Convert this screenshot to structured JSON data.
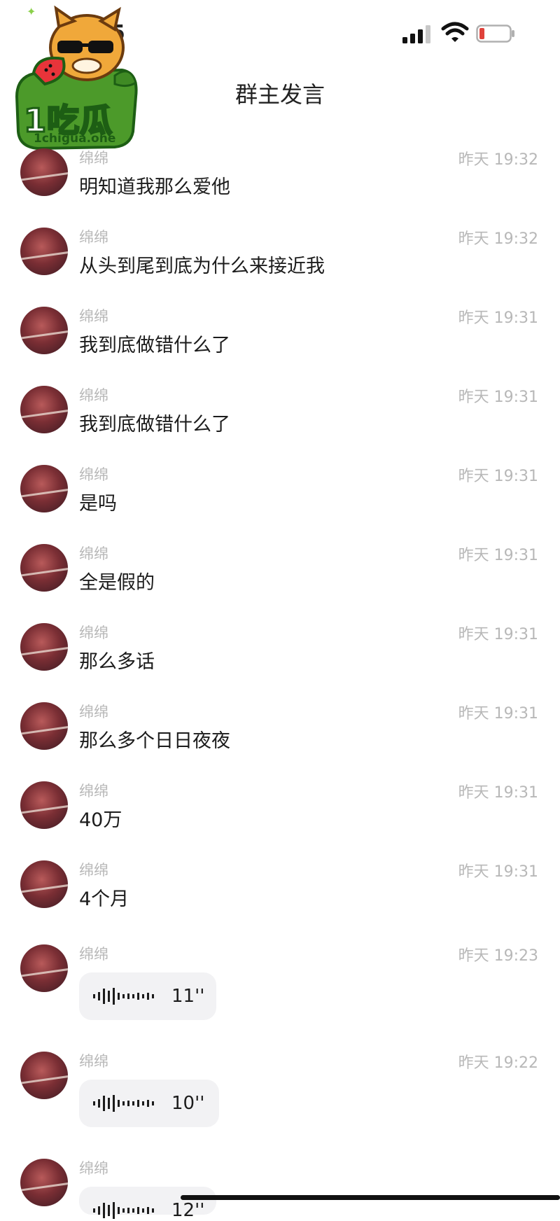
{
  "status_bar": {
    "time": "5"
  },
  "logo": {
    "title": "1吃瓜",
    "site": "1chigua.one"
  },
  "header": {
    "title": "群主发言"
  },
  "messages": [
    {
      "sender": "绵绵",
      "time": "昨天 19:32",
      "text": "明知道我那么爱他"
    },
    {
      "sender": "绵绵",
      "time": "昨天 19:32",
      "text": "从头到尾到底为什么来接近我"
    },
    {
      "sender": "绵绵",
      "time": "昨天 19:31",
      "text": "我到底做错什么了"
    },
    {
      "sender": "绵绵",
      "time": "昨天 19:31",
      "text": "我到底做错什么了"
    },
    {
      "sender": "绵绵",
      "time": "昨天 19:31",
      "text": "是吗"
    },
    {
      "sender": "绵绵",
      "time": "昨天 19:31",
      "text": "全是假的"
    },
    {
      "sender": "绵绵",
      "time": "昨天 19:31",
      "text": "那么多话"
    },
    {
      "sender": "绵绵",
      "time": "昨天 19:31",
      "text": "那么多个日日夜夜"
    },
    {
      "sender": "绵绵",
      "time": "昨天 19:31",
      "text": "40万"
    },
    {
      "sender": "绵绵",
      "time": "昨天 19:31",
      "text": "4个月"
    }
  ],
  "voice_messages": [
    {
      "sender": "绵绵",
      "time": "昨天 19:23",
      "duration": "11''"
    },
    {
      "sender": "绵绵",
      "time": "昨天 19:22",
      "duration": "10''"
    },
    {
      "sender": "绵绵",
      "time": "",
      "duration": "12''"
    }
  ]
}
